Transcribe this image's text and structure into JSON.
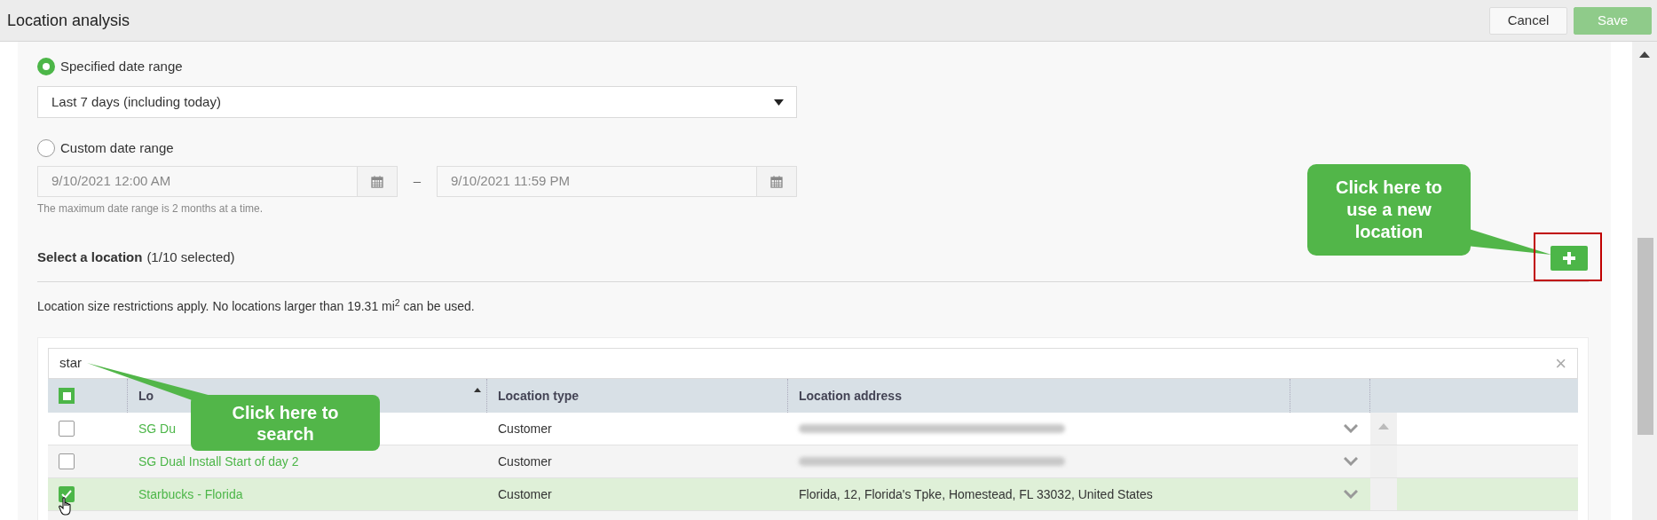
{
  "header": {
    "title": "Location analysis",
    "buttons": [
      {
        "label": "Cancel",
        "kind": "secondary"
      },
      {
        "label": "Save",
        "kind": "primary",
        "disabled": true
      }
    ]
  },
  "date_options": [
    {
      "label": "Specified date range",
      "selected": true,
      "kind": "select",
      "value": "Last 7 days (including today)"
    },
    {
      "label": "Custom date range",
      "selected": false,
      "kind": "range",
      "start": "9/10/2021 12:00 AM",
      "separator": "–",
      "end": "9/10/2021 11:59 PM",
      "hint": "The maximum date range is 2 months at a time."
    }
  ],
  "location": {
    "title": "Select a location",
    "count": "(1/10 selected)",
    "note": "Location size restrictions apply. No locations larger than 19.31 mi$^{2}$ can be used.",
    "search": {
      "value": "star",
      "clear": "×"
    },
    "select_all_partial": true,
    "columns": [
      {
        "label": "Lo",
        "sorted": true
      },
      {
        "label": "Location type",
        "sorted": false
      },
      {
        "label": "Location address",
        "sorted": false
      }
    ],
    "rows": [
      {
        "name": "SG Du",
        "type": "Customer",
        "blurred": true,
        "checked": false,
        "selected": false
      },
      {
        "name": "SG Dual Install Start of day 2",
        "type": "Customer",
        "blurred": true,
        "checked": false,
        "selected": false
      },
      {
        "name": "Starbucks - Florida",
        "type": "Customer",
        "address": "Florida, 12, Florida's Tpke, Homestead, FL 33032, United States",
        "blurred": false,
        "checked": true,
        "selected": true
      }
    ]
  },
  "callouts": [
    {
      "kind": "add",
      "text": "Click here to use a new location"
    },
    {
      "kind": "search",
      "text": "Click here to search"
    }
  ]
}
